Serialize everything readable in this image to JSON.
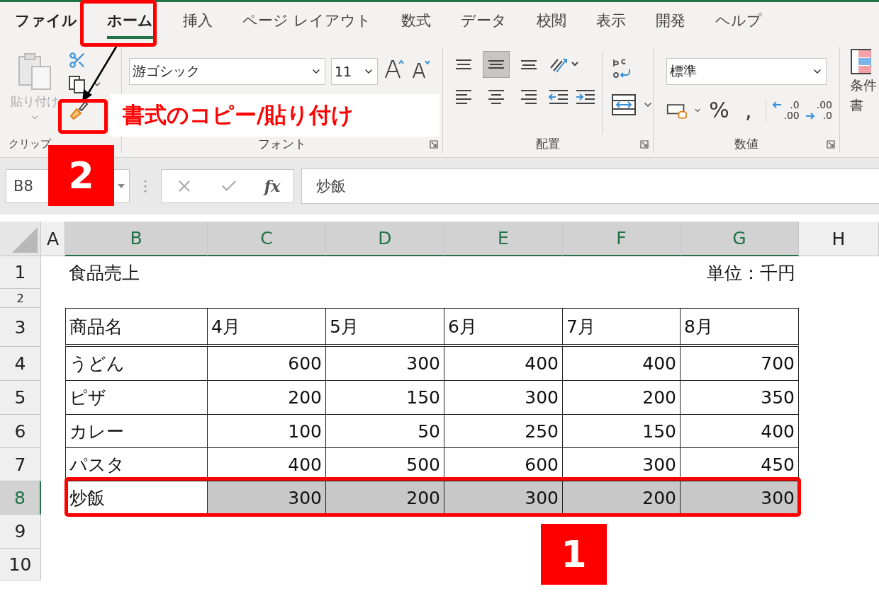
{
  "tabs": [
    {
      "label": "ファイル",
      "selected": false
    },
    {
      "label": "ホーム",
      "selected": true
    },
    {
      "label": "挿入",
      "selected": false
    },
    {
      "label": "ページ レイアウト",
      "selected": false
    },
    {
      "label": "数式",
      "selected": false
    },
    {
      "label": "データ",
      "selected": false
    },
    {
      "label": "校閲",
      "selected": false
    },
    {
      "label": "表示",
      "selected": false
    },
    {
      "label": "開発",
      "selected": false
    },
    {
      "label": "ヘルプ",
      "selected": false
    }
  ],
  "ribbon": {
    "clipboard": {
      "paste_label": "貼り付け",
      "label": "クリップ"
    },
    "font": {
      "font_name": "游ゴシック",
      "font_size": "11",
      "label": "フォント"
    },
    "alignment": {
      "vertical_buttons": [
        {
          "selected": false
        },
        {
          "selected": true
        },
        {
          "selected": false
        }
      ],
      "label": "配置"
    },
    "number": {
      "format": "標準",
      "symbol_buttons": [
        "%",
        ","
      ],
      "decimal_buttons": [
        {
          "top": ".0",
          "bottom": ".00"
        },
        {
          "top": ".00",
          "bottom": ".0"
        }
      ],
      "label": "数値"
    },
    "styles": {
      "lines": [
        "条件",
        "書"
      ]
    }
  },
  "formula_bar": {
    "name_box": "B8",
    "function_label": "fx",
    "formula": "炒飯"
  },
  "sheet": {
    "columns": [
      {
        "label": "A",
        "selected": false
      },
      {
        "label": "B",
        "selected": true
      },
      {
        "label": "C",
        "selected": true
      },
      {
        "label": "D",
        "selected": true
      },
      {
        "label": "E",
        "selected": true
      },
      {
        "label": "F",
        "selected": true
      },
      {
        "label": "G",
        "selected": true
      },
      {
        "label": "H",
        "selected": false
      }
    ],
    "rows": [
      {
        "header": "1",
        "selected": false,
        "kind": "title",
        "title": "食品売上",
        "unit": "単位：千円"
      },
      {
        "header": "2",
        "selected": false,
        "kind": "spacer"
      },
      {
        "header": "3",
        "selected": false,
        "kind": "table_header",
        "cells": [
          "商品名",
          "4月",
          "5月",
          "6月",
          "7月",
          "8月"
        ]
      },
      {
        "header": "4",
        "selected": false,
        "kind": "table_row",
        "cells": [
          "うどん",
          "600",
          "300",
          "400",
          "400",
          "700"
        ]
      },
      {
        "header": "5",
        "selected": false,
        "kind": "table_row",
        "cells": [
          "ピザ",
          "200",
          "150",
          "300",
          "200",
          "350"
        ]
      },
      {
        "header": "6",
        "selected": false,
        "kind": "table_row",
        "cells": [
          "カレー",
          "100",
          "50",
          "250",
          "150",
          "400"
        ]
      },
      {
        "header": "7",
        "selected": false,
        "kind": "table_row",
        "cells": [
          "パスタ",
          "400",
          "500",
          "600",
          "300",
          "450"
        ]
      },
      {
        "header": "8",
        "selected": true,
        "kind": "table_row",
        "cells": [
          "炒飯",
          "300",
          "200",
          "300",
          "200",
          "300"
        ]
      },
      {
        "header": "9",
        "selected": false,
        "kind": "empty"
      },
      {
        "header": "10",
        "selected": false,
        "kind": "empty"
      }
    ]
  },
  "annotations": {
    "note": "書式のコピー/貼り付け",
    "steps": [
      "2",
      "1"
    ]
  }
}
